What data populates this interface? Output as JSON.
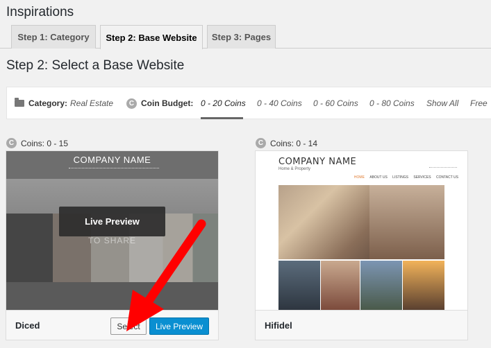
{
  "page": {
    "title": "Inspirations"
  },
  "tabs": [
    {
      "label": "Step 1: Category",
      "active": false
    },
    {
      "label": "Step 2: Base Website",
      "active": true
    },
    {
      "label": "Step 3: Pages",
      "active": false
    }
  ],
  "section": {
    "title": "Step 2: Select a Base Website"
  },
  "filters": {
    "category_label": "Category:",
    "category_value": "Real Estate",
    "coin_budget_label": "Coin Budget:",
    "coin_options": [
      "0 - 20 Coins",
      "0 - 40 Coins",
      "0 - 60 Coins",
      "0 - 80 Coins",
      "Show All",
      "Free"
    ],
    "active_coin_option": "0 - 20 Coins"
  },
  "cards": [
    {
      "coins_label": "Coins: 0 - 15",
      "name": "Diced",
      "thumb_company": "COMPANY NAME",
      "thumb_tagline": "TO SHARE",
      "overlay_button": "Live Preview",
      "select_button": "Select",
      "live_preview_button": "Live Preview"
    },
    {
      "coins_label": "Coins: 0 - 14",
      "name": "Hifidel",
      "thumb_company": "COMPANY NAME",
      "thumb_subtitle": "Home & Property",
      "thumb_nav": [
        "HOME",
        "ABOUT US",
        "LISTINGS",
        "SERVICES",
        "CONTACT US"
      ]
    }
  ],
  "icons": {
    "folder": "folder-icon",
    "coin": "coin-icon",
    "coin_glyph": "C"
  },
  "colors": {
    "primary_button": "#0a8fd1",
    "arrow": "#ff0000"
  }
}
